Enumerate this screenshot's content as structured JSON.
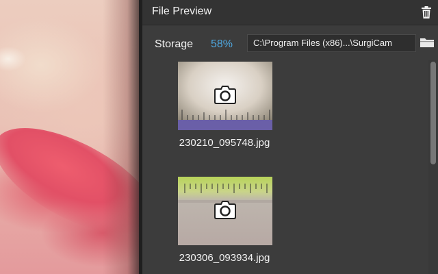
{
  "panel": {
    "title": "File Preview",
    "trash_icon": "trash-icon"
  },
  "storage": {
    "label": "Storage",
    "percent": "58%",
    "path": "C:\\Program Files (x86)...\\SurgiCam",
    "folder_icon": "folder-icon"
  },
  "files": [
    {
      "name": "230210_095748.jpg",
      "icon": "camera-icon"
    },
    {
      "name": "230306_093934.jpg",
      "icon": "camera-icon"
    }
  ],
  "colors": {
    "accent": "#4fa8e0",
    "panel_bg": "#3c3c3c",
    "header_bg": "#333333"
  }
}
